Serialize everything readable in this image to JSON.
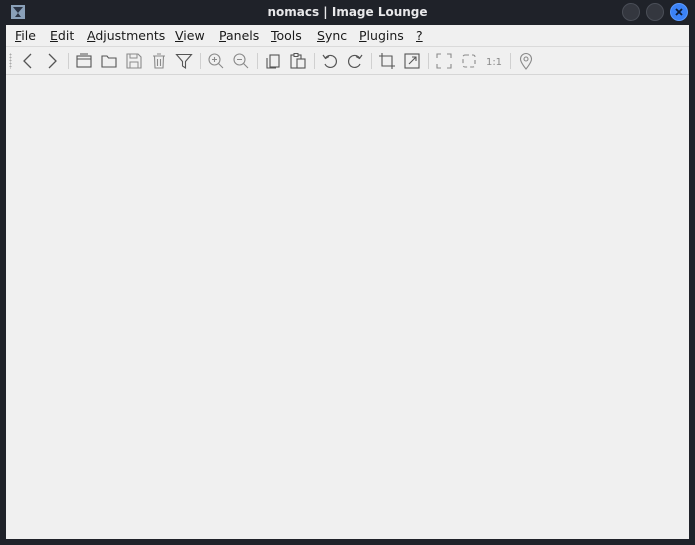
{
  "window": {
    "title": "nomacs | Image Lounge",
    "controls": [
      "minimize-icon",
      "maximize-icon",
      "close-icon"
    ],
    "accent_color": "#3b82f6"
  },
  "menubar": {
    "items": [
      {
        "label": "File",
        "accel": "F",
        "rest": "ile"
      },
      {
        "label": "Edit",
        "accel": "E",
        "rest": "dit"
      },
      {
        "label": "Adjustments",
        "accel": "A",
        "rest": "djustments"
      },
      {
        "label": "View",
        "accel": "V",
        "rest": "iew"
      },
      {
        "label": "Panels",
        "accel": "P",
        "rest": "anels"
      },
      {
        "label": "Tools",
        "accel": "T",
        "rest": "ools"
      },
      {
        "label": "Sync",
        "accel": "S",
        "rest": "ync"
      },
      {
        "label": "Plugins",
        "accel": "P",
        "rest": "lugins"
      },
      {
        "label": "?",
        "accel": "?",
        "rest": ""
      }
    ]
  },
  "toolbar": {
    "icons": [
      "previous-icon",
      "next-icon",
      "open-icon",
      "open-folder-icon",
      "save-icon",
      "delete-icon",
      "filter-icon",
      "zoom-in-icon",
      "zoom-out-icon",
      "copy-icon",
      "paste-icon",
      "rotate-left-icon",
      "rotate-right-icon",
      "crop-icon",
      "resize-icon",
      "fullscreen-icon",
      "frameless-icon",
      "one-to-one-icon",
      "gps-icon"
    ],
    "one_to_one_label": "1:1"
  }
}
